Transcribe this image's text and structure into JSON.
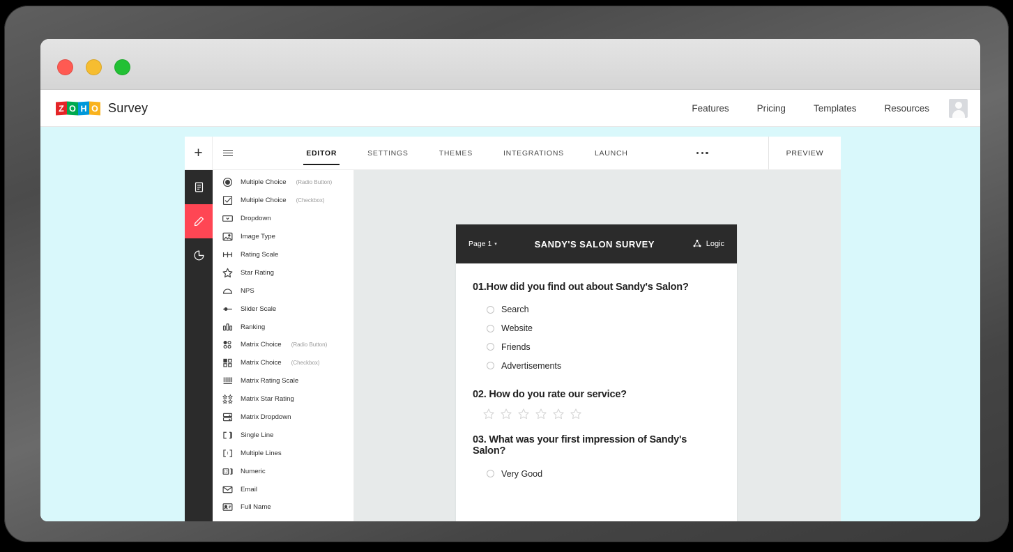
{
  "browser": {
    "traffic_lights": [
      "close",
      "minimize",
      "maximize"
    ]
  },
  "site_header": {
    "brand": {
      "logo_letters": [
        "Z",
        "O",
        "H",
        "O"
      ],
      "product": "Survey"
    },
    "nav": [
      {
        "label": "Features"
      },
      {
        "label": "Pricing"
      },
      {
        "label": "Templates"
      },
      {
        "label": "Resources"
      }
    ],
    "avatar_icon": "user-avatar-icon"
  },
  "app": {
    "toolbar": {
      "add_icon": "+",
      "list_icon": "list-icon"
    },
    "tabs": [
      {
        "label": "EDITOR",
        "active": true
      },
      {
        "label": "SETTINGS",
        "active": false
      },
      {
        "label": "THEMES",
        "active": false
      },
      {
        "label": "INTEGRATIONS",
        "active": false
      },
      {
        "label": "LAUNCH",
        "active": false
      }
    ],
    "more_label": "...",
    "preview_label": "PREVIEW",
    "rail": [
      {
        "name": "pages-icon",
        "active": false
      },
      {
        "name": "edit-pencil-icon",
        "active": true
      },
      {
        "name": "reports-pie-icon",
        "active": false
      }
    ],
    "accent_color": "#ff4654",
    "question_types": [
      {
        "label": "Multiple Choice",
        "sub": "(Radio Button)",
        "icon": "radio-button-icon"
      },
      {
        "label": "Multiple Choice",
        "sub": "(Checkbox)",
        "icon": "checkbox-icon"
      },
      {
        "label": "Dropdown",
        "sub": "",
        "icon": "dropdown-icon"
      },
      {
        "label": "Image Type",
        "sub": "",
        "icon": "image-icon"
      },
      {
        "label": "Rating Scale",
        "sub": "",
        "icon": "rating-scale-icon"
      },
      {
        "label": "Star Rating",
        "sub": "",
        "icon": "star-icon"
      },
      {
        "label": "NPS",
        "sub": "",
        "icon": "nps-gauge-icon"
      },
      {
        "label": "Slider Scale",
        "sub": "",
        "icon": "slider-icon"
      },
      {
        "label": "Ranking",
        "sub": "",
        "icon": "ranking-bars-icon"
      },
      {
        "label": "Matrix Choice",
        "sub": "(Radio Button)",
        "icon": "matrix-radio-icon"
      },
      {
        "label": "Matrix Choice",
        "sub": "(Checkbox)",
        "icon": "matrix-checkbox-icon"
      },
      {
        "label": "Matrix Rating Scale",
        "sub": "",
        "icon": "matrix-rating-icon"
      },
      {
        "label": "Matrix Star Rating",
        "sub": "",
        "icon": "matrix-star-icon"
      },
      {
        "label": "Matrix Dropdown",
        "sub": "",
        "icon": "matrix-dropdown-icon"
      },
      {
        "label": "Single Line",
        "sub": "",
        "icon": "single-line-icon"
      },
      {
        "label": "Multiple Lines",
        "sub": "",
        "icon": "multiple-lines-icon"
      },
      {
        "label": "Numeric",
        "sub": "",
        "icon": "numeric-icon"
      },
      {
        "label": "Email",
        "sub": "",
        "icon": "email-icon"
      },
      {
        "label": "Full Name",
        "sub": "",
        "icon": "full-name-icon"
      }
    ]
  },
  "survey": {
    "page_label": "Page 1",
    "title": "SANDY'S SALON SURVEY",
    "logic_label": "Logic",
    "questions": [
      {
        "text": "01.How did you find out about Sandy's Salon?",
        "type": "radio",
        "options": [
          "Search",
          "Website",
          "Friends",
          "Advertisements"
        ]
      },
      {
        "text": "02. How do you rate our service?",
        "type": "stars",
        "star_count": 6,
        "options": []
      },
      {
        "text": "03. What was your first impression of Sandy's Salon?",
        "type": "radio",
        "options": [
          "Very Good"
        ]
      }
    ]
  }
}
